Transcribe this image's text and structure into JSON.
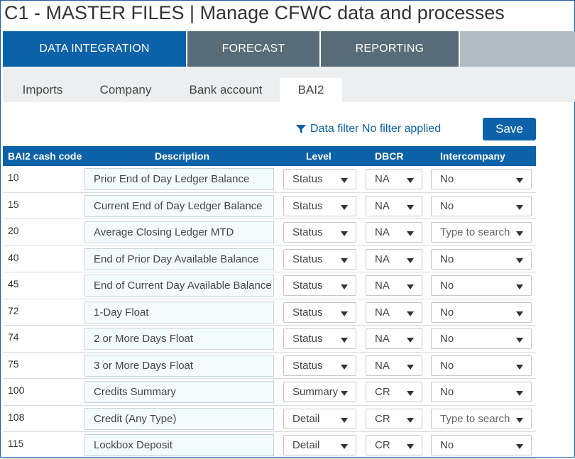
{
  "app": {
    "title": "C1 - MASTER FILES | Manage CFWC data and processes"
  },
  "main_nav": {
    "tabs": [
      {
        "label": "DATA INTEGRATION",
        "active": true
      },
      {
        "label": "FORECAST",
        "active": false
      },
      {
        "label": "REPORTING",
        "active": false
      }
    ]
  },
  "sub_tabs": {
    "tabs": [
      {
        "label": "Imports",
        "active": false
      },
      {
        "label": "Company",
        "active": false
      },
      {
        "label": "Bank account",
        "active": false
      },
      {
        "label": "BAI2",
        "active": true
      }
    ]
  },
  "filter": {
    "label": "Data filter",
    "status": "No filter applied"
  },
  "toolbar": {
    "save_label": "Save"
  },
  "table": {
    "headers": {
      "code": "BAI2 cash code",
      "description": "Description",
      "level": "Level",
      "dbcr": "DBCR",
      "intercompany": "Intercompany"
    },
    "rows": [
      {
        "code": "10",
        "description": "Prior End of Day Ledger Balance",
        "level": "Status",
        "dbcr": "NA",
        "intercompany": "No",
        "intercompany_placeholder": false
      },
      {
        "code": "15",
        "description": "Current End of Day Ledger Balance",
        "level": "Status",
        "dbcr": "NA",
        "intercompany": "No",
        "intercompany_placeholder": false
      },
      {
        "code": "20",
        "description": "Average Closing Ledger MTD",
        "level": "Status",
        "dbcr": "NA",
        "intercompany": "Type to search",
        "intercompany_placeholder": true
      },
      {
        "code": "40",
        "description": "End of Prior Day Available Balance",
        "level": "Status",
        "dbcr": "NA",
        "intercompany": "No",
        "intercompany_placeholder": false
      },
      {
        "code": "45",
        "description": "End of Current Day Available Balance",
        "level": "Status",
        "dbcr": "NA",
        "intercompany": "No",
        "intercompany_placeholder": false
      },
      {
        "code": "72",
        "description": "1-Day Float",
        "level": "Status",
        "dbcr": "NA",
        "intercompany": "No",
        "intercompany_placeholder": false
      },
      {
        "code": "74",
        "description": "2 or More Days Float",
        "level": "Status",
        "dbcr": "NA",
        "intercompany": "No",
        "intercompany_placeholder": false
      },
      {
        "code": "75",
        "description": "3 or More Days Float",
        "level": "Status",
        "dbcr": "NA",
        "intercompany": "No",
        "intercompany_placeholder": false
      },
      {
        "code": "100",
        "description": "Credits Summary",
        "level": "Summary",
        "dbcr": "CR",
        "intercompany": "No",
        "intercompany_placeholder": false
      },
      {
        "code": "108",
        "description": "Credit (Any Type)",
        "level": "Detail",
        "dbcr": "CR",
        "intercompany": "Type to search",
        "intercompany_placeholder": true
      },
      {
        "code": "115",
        "description": "Lockbox Deposit",
        "level": "Detail",
        "dbcr": "CR",
        "intercompany": "No",
        "intercompany_placeholder": false
      }
    ]
  },
  "colors": {
    "primary": "#0b62a8",
    "nav_inactive": "#576c76",
    "nav_bg": "#b1bcc3",
    "subtab_bg": "#eceeef",
    "input_bg": "#f4fbfc"
  },
  "icons": {
    "filter": "funnel-icon",
    "dropdown": "caret-down-icon"
  }
}
